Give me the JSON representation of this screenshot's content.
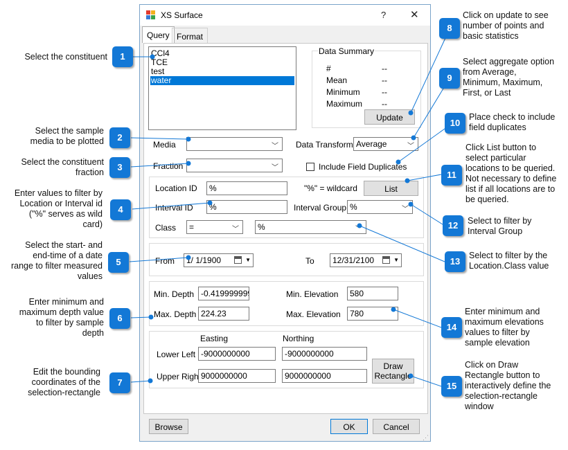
{
  "window": {
    "title": "XS Surface",
    "help": "?",
    "close": "✕"
  },
  "tabs": [
    {
      "label": "Query"
    },
    {
      "label": "Format"
    }
  ],
  "constituents": [
    "CCl4",
    "TCE",
    "test",
    "water"
  ],
  "data_summary": {
    "title": "Data Summary",
    "rows": [
      {
        "label": "#",
        "value": "--"
      },
      {
        "label": "Mean",
        "value": "--"
      },
      {
        "label": "Minimum",
        "value": "--"
      },
      {
        "label": "Maximum",
        "value": "--"
      }
    ],
    "update_label": "Update"
  },
  "media": {
    "label": "Media",
    "value": ""
  },
  "data_transform": {
    "label": "Data Transform",
    "value": "Average"
  },
  "fraction": {
    "label": "Fraction",
    "value": ""
  },
  "include_duplicates": {
    "label": "Include Field Duplicates",
    "checked": false
  },
  "location": {
    "location_label": "Location ID",
    "location_value": "%",
    "wildcard_note": "\"%\" = wildcard",
    "list_label": "List",
    "interval_label": "Interval ID",
    "interval_value": "%",
    "interval_group_label": "Interval Group",
    "interval_group_value": "%",
    "class_label": "Class",
    "class_op": "=",
    "class_value": "%"
  },
  "dates": {
    "from_label": "From",
    "from_value": "1/ 1/1900",
    "to_label": "To",
    "to_value": "12/31/2100"
  },
  "depth": {
    "min_depth_label": "Min. Depth",
    "min_depth_value": "-0.419999999",
    "max_depth_label": "Max. Depth",
    "max_depth_value": "224.23",
    "min_elev_label": "Min. Elevation",
    "min_elev_value": "580",
    "max_elev_label": "Max. Elevation",
    "max_elev_value": "780"
  },
  "rect": {
    "easting_label": "Easting",
    "northing_label": "Northing",
    "lower_left_label": "Lower Left",
    "upper_right_label": "Upper Right",
    "ll_easting": "-9000000000",
    "ll_northing": "-9000000000",
    "ur_easting": "9000000000",
    "ur_northing": "9000000000",
    "draw_label_1": "Draw",
    "draw_label_2": "Rectangle"
  },
  "footer": {
    "browse_label": "Browse",
    "ok_label": "OK",
    "cancel_label": "Cancel"
  },
  "callouts": [
    {
      "num": "1",
      "text": [
        "Select the constituent"
      ]
    },
    {
      "num": "2",
      "text": [
        "Select the sample",
        "media to be plotted"
      ]
    },
    {
      "num": "3",
      "text": [
        "Select the constituent",
        "fraction"
      ]
    },
    {
      "num": "4",
      "text": [
        "Enter values to filter by",
        "Location or Interval id",
        "(\"%\" serves as wild",
        "card)"
      ]
    },
    {
      "num": "5",
      "text": [
        "Select the start- and",
        "end-time of a date",
        "range to filter measured",
        "values"
      ]
    },
    {
      "num": "6",
      "text": [
        "Enter minimum and",
        "maximum depth value",
        "to filter by sample",
        "depth"
      ]
    },
    {
      "num": "7",
      "text": [
        "Edit the bounding",
        "coordinates of the",
        "selection-rectangle"
      ]
    },
    {
      "num": "8",
      "text": [
        "Click on update to see",
        "number of points and",
        "basic statistics"
      ]
    },
    {
      "num": "9",
      "text": [
        "Select aggregate option",
        "from Average,",
        "Minimum, Maximum,",
        "First, or Last"
      ]
    },
    {
      "num": "10",
      "text": [
        "Place check to include",
        "field duplicates"
      ]
    },
    {
      "num": "11",
      "text": [
        "Click List button to",
        "select particular",
        "locations to be queried.",
        "Not necessary to define",
        "list if all locations are to",
        "be queried."
      ]
    },
    {
      "num": "12",
      "text": [
        "Select to filter by",
        "Interval Group"
      ]
    },
    {
      "num": "13",
      "text": [
        "Select to filter by the",
        "Location.Class value"
      ]
    },
    {
      "num": "14",
      "text": [
        "Enter minimum and",
        "maximum elevations",
        "values to filter by",
        "sample elevation"
      ]
    },
    {
      "num": "15",
      "text": [
        "Click on Draw",
        "Rectangle button to",
        "interactively define the",
        "selection-rectangle",
        "window"
      ]
    }
  ],
  "colors": {
    "accent": "#1378d6",
    "selection": "#0078d7",
    "dialog_bg": "#f0f0f0"
  }
}
